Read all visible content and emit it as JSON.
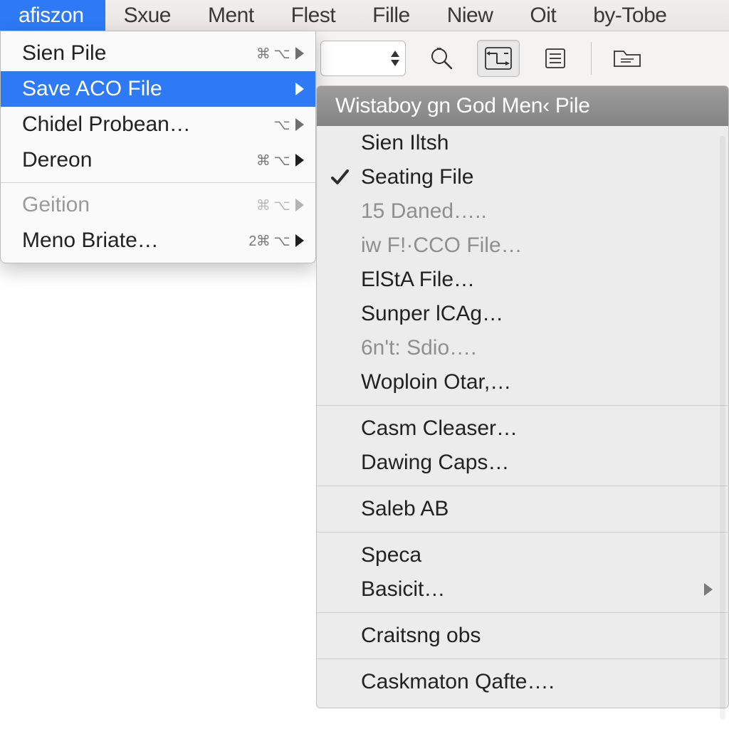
{
  "menubar": {
    "items": [
      {
        "label": "afiszon",
        "active": true
      },
      {
        "label": "Sxue"
      },
      {
        "label": "Ment"
      },
      {
        "label": "Flest"
      },
      {
        "label": "Fille"
      },
      {
        "label": "Niew"
      },
      {
        "label": "Oit"
      },
      {
        "label": "by-Tobe"
      }
    ]
  },
  "dropdown": {
    "items": [
      {
        "label": "Sien Pile",
        "shortcut": "⌘  ⌥",
        "arrow": "dim"
      },
      {
        "label": "Save ACO File",
        "highlight": true,
        "arrow": "white"
      },
      {
        "label": "Chidel Probean…",
        "shortcut": "⌥",
        "arrow": "dim"
      },
      {
        "label": "Dereon",
        "shortcut": "⌘  ⌥",
        "arrow": "bold"
      }
    ],
    "items2": [
      {
        "label": "Geition",
        "shortcut": "⌘  ⌥",
        "arrow": "dim",
        "dim": true
      },
      {
        "label": "Meno Briate…",
        "shortcut": "2⌘ ⌥",
        "arrow": "bold"
      }
    ]
  },
  "submenu": {
    "header": "Wistaboy gn God Men‹ Pile",
    "groups": [
      [
        {
          "label": "Sien Iltsh"
        },
        {
          "label": "Seating File",
          "checked": true,
          "dim": true
        },
        {
          "label": "15 Daned…..",
          "dim": true
        },
        {
          "label": "iw F!·CCO File…",
          "dim": true
        },
        {
          "label": "ElStA File…"
        },
        {
          "label": "Sunper lCAg…"
        },
        {
          "label": "6n't: Sdio….",
          "dim": true
        },
        {
          "label": "Woploin Otar,…"
        }
      ],
      [
        {
          "label": "Casm Cleaser…"
        },
        {
          "label": "Dawing Caps…"
        }
      ],
      [
        {
          "label": "Saleb AB"
        }
      ],
      [
        {
          "label": "Speca"
        },
        {
          "label": "Basicit…",
          "arrow": true
        }
      ],
      [
        {
          "label": "Craitsng obs"
        }
      ],
      [
        {
          "label": "Caskmaton Qafte…."
        }
      ]
    ]
  },
  "toolbar": {
    "icons": [
      "magnify",
      "flowchart",
      "document",
      "folder"
    ]
  }
}
